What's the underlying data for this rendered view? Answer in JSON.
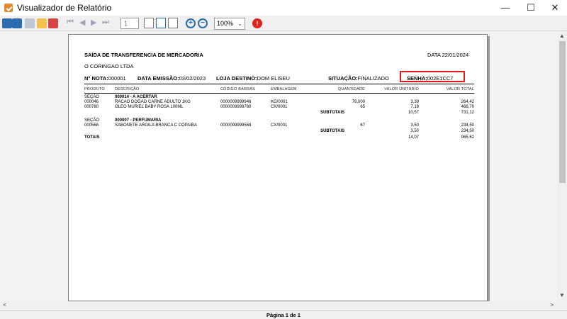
{
  "window": {
    "title": "Visualizador de Relatório",
    "controls": {
      "minimize": "—",
      "maximize": "☐",
      "close": "✕"
    }
  },
  "toolbar": {
    "page_number": "1",
    "zoom": "100%"
  },
  "report": {
    "title": "SAÍDA DE TRANSFERENCIA DE MERCADORIA",
    "date_label": "DATA",
    "date": "22/01/2024",
    "company": "O CORINGAO LTDA",
    "nota_label": "N° NOTA:",
    "nota": "000001",
    "emissao_label": "DATA EMISSÃO:",
    "emissao": "03/02/2023",
    "loja_label": "LOJA DESTINO:",
    "loja": "DOM ELISEU",
    "situacao_label": "SITUAÇÃO:",
    "situacao": "FINALIZADO",
    "senha_label": "SENHA:",
    "senha": "002E1CC7",
    "columns": [
      "PRODUTO",
      "DESCRIÇÃO",
      "CÓDIGO BARRAS",
      "EMBALAGEM",
      "QUANTIDADE",
      "VALOR UNITÁRIO",
      "VALOR TOTAL"
    ],
    "sections": [
      {
        "label": "SEÇÃO",
        "name": "000014 - A ACERTAR",
        "rows": [
          {
            "produto": "000046",
            "descricao": "RACAO DOGAO CARNE ADULTO 1KG",
            "codigo": "0000009999946",
            "embalagem": "KG/0001",
            "quantidade": "78,000",
            "unitario": "3,39",
            "total": "264,42"
          },
          {
            "produto": "000780",
            "descricao": "OLEO MURIEL BABY ROSA 100ML",
            "codigo": "0000009999780",
            "embalagem": "CX/0001",
            "quantidade": "65",
            "unitario": "7,18",
            "total": "466,70"
          }
        ],
        "subtotal_label": "SUBTOTAIS",
        "subtotal_unitario": "10,57",
        "subtotal_total": "731,12"
      },
      {
        "label": "SEÇÃO",
        "name": "000007 - PERFUMARIA",
        "rows": [
          {
            "produto": "000568",
            "descricao": "SABONETE ARGILA BRANCA C COPAIBA",
            "codigo": "0000099999568",
            "embalagem": "CX/0001",
            "quantidade": "67",
            "unitario": "3,50",
            "total": "234,50"
          }
        ],
        "subtotal_label": "SUBTOTAIS",
        "subtotal_unitario": "3,50",
        "subtotal_total": "234,50"
      }
    ],
    "totals_label": "TOTAIS",
    "totals_unitario": "14,07",
    "totals_total": "965,62"
  },
  "status": {
    "page_text": "Página 1 de 1"
  },
  "colors": {
    "highlight": "#e01818",
    "accent": "#2b6cb0"
  }
}
